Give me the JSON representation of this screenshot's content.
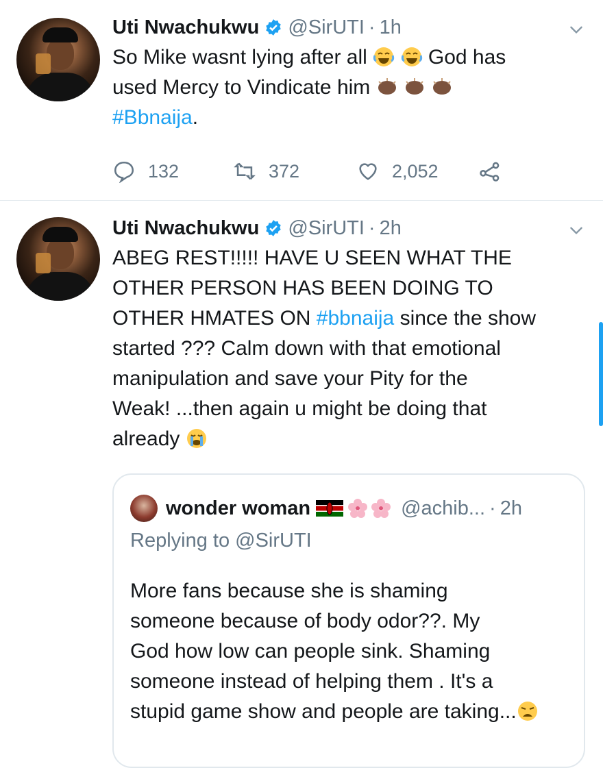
{
  "tweets": [
    {
      "name": "Uti Nwachukwu",
      "handle": "@SirUTI",
      "time": "1h",
      "line1": "So Mike wasnt lying after all",
      "line1b": "God has",
      "line2": "used Mercy to Vindicate him",
      "hashtag": "#Bbnaija",
      "hashtag_suffix": ".",
      "replies": "132",
      "retweets": "372",
      "likes": "2,052"
    },
    {
      "name": "Uti Nwachukwu",
      "handle": "@SirUTI",
      "time": "2h",
      "line1": "ABEG REST!!!!! HAVE U SEEN WHAT THE",
      "line2": "OTHER PERSON HAS BEEN DOING TO",
      "line3a": "OTHER HMATES ON ",
      "line3_hashtag": "#bbnaija",
      "line3b": " since the show",
      "line4": "started ??? Calm down with that emotional",
      "line5": "manipulation and save your Pity for the",
      "line6": "Weak! ...then again u might be doing that",
      "line7": "already"
    }
  ],
  "quote": {
    "name": "wonder woman",
    "handle": "@achib...",
    "time": "2h",
    "replying": "Replying to @SirUTI",
    "lines": [
      "More fans because she is shaming",
      "someone  because  of body odor??. My",
      "God how low can people  sink. Shaming",
      "someone instead of helping  them . It's a",
      "stupid game show and people are taking..."
    ]
  },
  "icons": {
    "verified": "verified-badge-icon",
    "reply": "reply-icon",
    "retweet": "retweet-icon",
    "like": "heart-icon",
    "share": "share-icon",
    "more": "chevron-down-icon",
    "emoji_joy": "face-with-tears-of-joy",
    "emoji_clap": "clapping-hands-dark-skin",
    "emoji_cry": "loudly-crying-face",
    "emoji_weary": "weary-face",
    "flag": "kenya-flag",
    "flower": "cherry-blossom"
  },
  "colors": {
    "link": "#1da1f2",
    "secondary": "#657786",
    "border": "#e1e8ed"
  }
}
